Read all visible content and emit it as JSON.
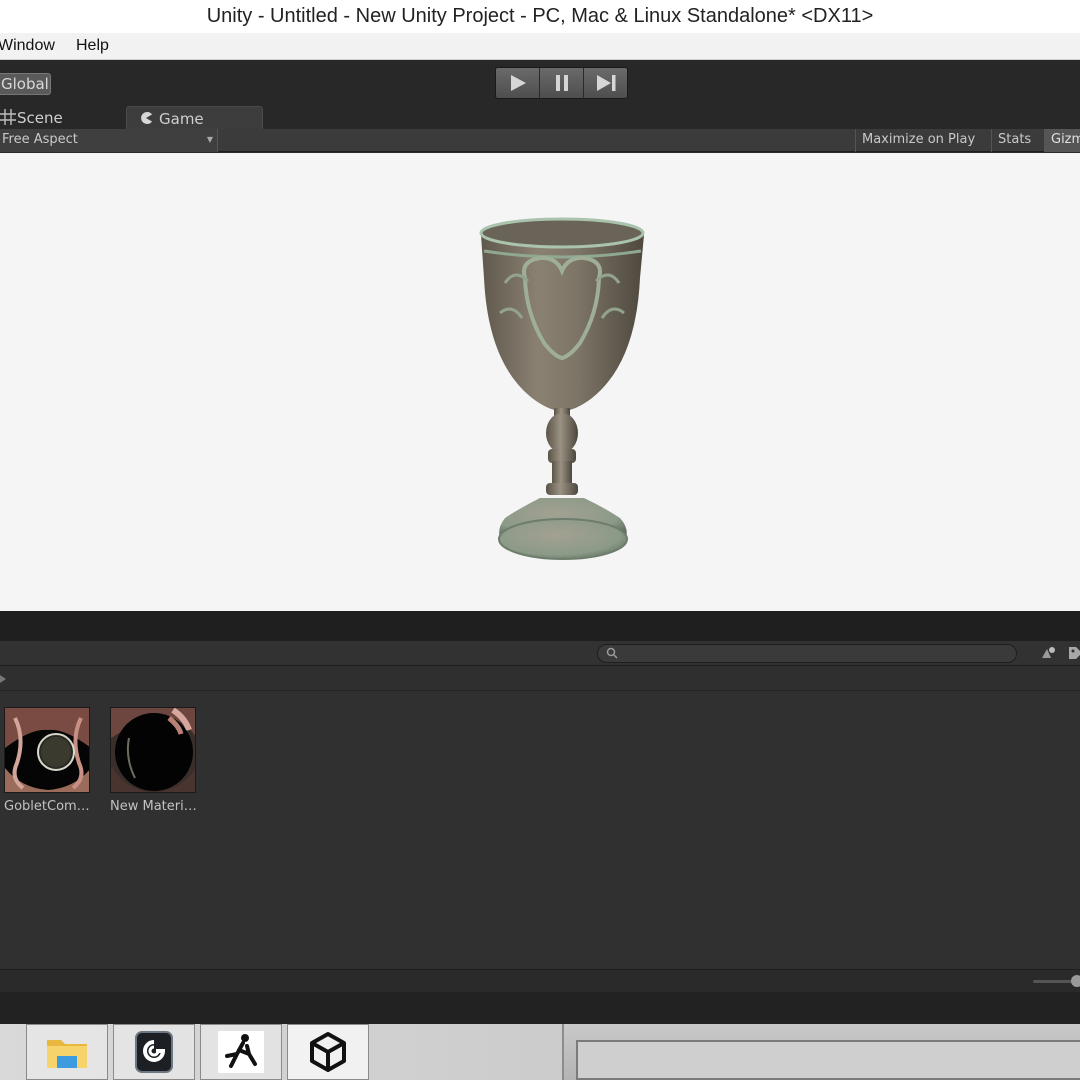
{
  "window": {
    "title": "Unity - Untitled - New Unity Project - PC, Mac & Linux Standalone* <DX11>"
  },
  "menu": {
    "items": [
      "Window",
      "Help"
    ]
  },
  "toolbar": {
    "pivot_mode": "Global"
  },
  "tabs": {
    "scene": "Scene",
    "game": "Game"
  },
  "game_view": {
    "aspect": "Free Aspect",
    "maximize_on_play": "Maximize on Play",
    "stats": "Stats",
    "gizmos": "Gizm"
  },
  "project": {
    "search": {
      "placeholder": ""
    },
    "assets": [
      {
        "label": "GobletCom…",
        "kind": "material"
      },
      {
        "label": "New Materi…",
        "kind": "material"
      }
    ]
  },
  "taskbar": {
    "apps": [
      "file-explorer-icon",
      "spiral-app-icon",
      "zbrush-icon",
      "unity-icon"
    ]
  },
  "colors": {
    "editor_dark": "#2b2b2b",
    "viewport_bg": "#f5f5f5",
    "goblet_metal": "#7a7264",
    "patina": "#9fb9a2"
  }
}
